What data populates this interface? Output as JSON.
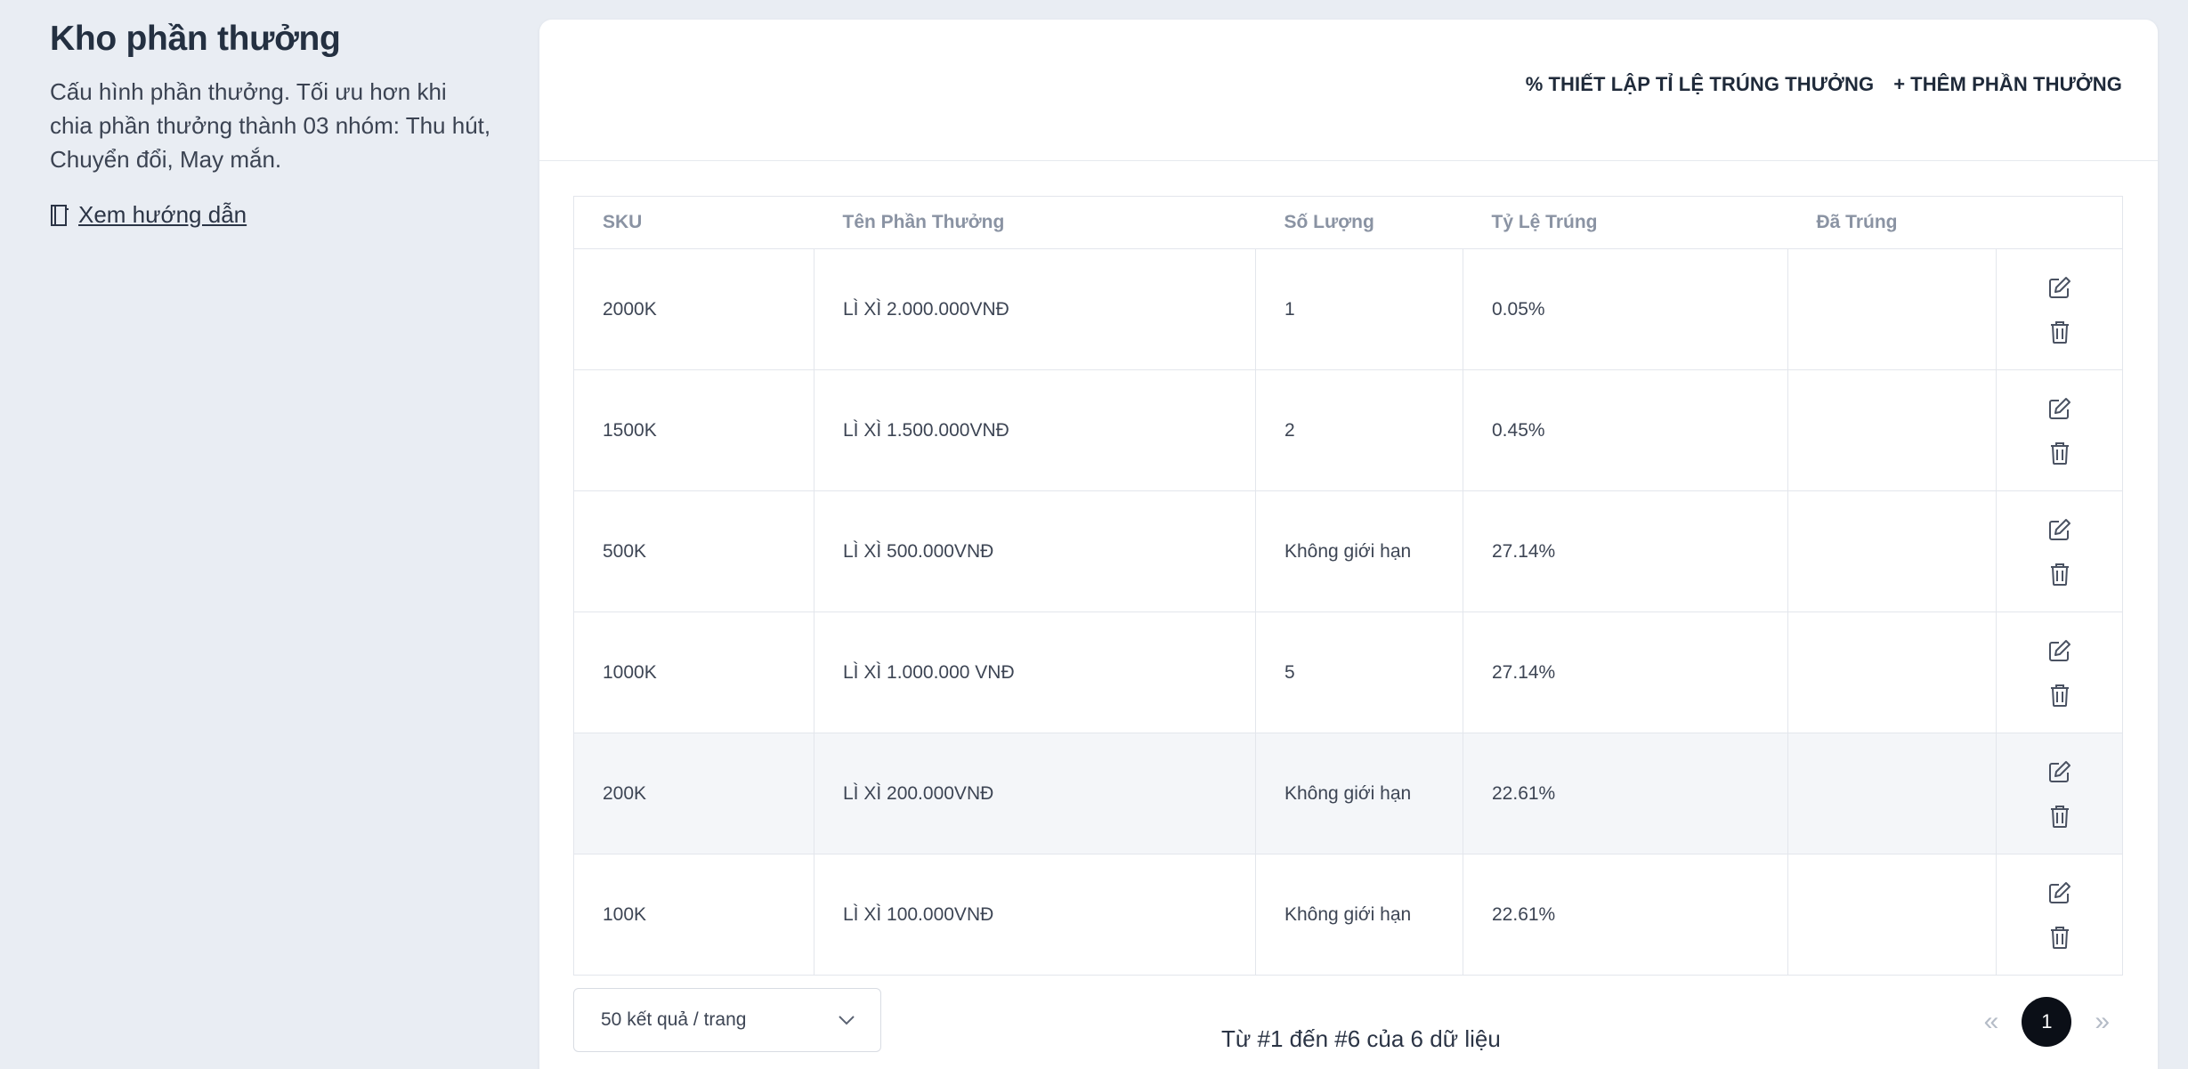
{
  "intro": {
    "title": "Kho phần thưởng",
    "description": "Cấu hình phần thưởng. Tối ưu hơn khi chia phần thưởng thành 03 nhóm: Thu hút, Chuyển đổi, May mắn.",
    "guide_link": "Xem hướng dẫn"
  },
  "toolbar": {
    "set_rate_icon": "%",
    "set_rate_label": "THIẾT LẬP TỈ LỆ TRÚNG THƯỞNG",
    "add_icon": "+",
    "add_label": "THÊM PHẦN THƯỞNG"
  },
  "table": {
    "columns": [
      "SKU",
      "Tên Phần Thưởng",
      "Số Lượng",
      "Tỷ Lệ Trúng",
      "Đã Trúng",
      ""
    ],
    "rows": [
      {
        "sku": "2000K",
        "name": "LÌ XÌ 2.000.000VNĐ",
        "qty": "1",
        "rate": "0.05%",
        "won": ""
      },
      {
        "sku": "1500K",
        "name": "LÌ XÌ 1.500.000VNĐ",
        "qty": "2",
        "rate": "0.45%",
        "won": ""
      },
      {
        "sku": "500K",
        "name": "LÌ XÌ 500.000VNĐ",
        "qty": "Không giới hạn",
        "rate": "27.14%",
        "won": ""
      },
      {
        "sku": "1000K",
        "name": "LÌ XÌ 1.000.000 VNĐ",
        "qty": "5",
        "rate": "27.14%",
        "won": ""
      },
      {
        "sku": "200K",
        "name": "LÌ XÌ 200.000VNĐ",
        "qty": "Không giới hạn",
        "rate": "22.61%",
        "won": ""
      },
      {
        "sku": "100K",
        "name": "LÌ XÌ 100.000VNĐ",
        "qty": "Không giới hạn",
        "rate": "22.61%",
        "won": ""
      }
    ]
  },
  "footer": {
    "per_page": "50 kết quả / trang",
    "summary": "Từ #1 đến #6 của 6 dữ liệu",
    "prev": "«",
    "current_page": "1",
    "next": "»"
  },
  "icons": {
    "guide": "book-icon",
    "edit": "edit-icon",
    "delete": "trash-icon",
    "dropdown": "chevron-down-icon"
  },
  "colors": {
    "background": "#e9edf3",
    "card": "#ffffff",
    "active_page": "#0b0f17",
    "highlight_row": "#f4f6f9"
  }
}
